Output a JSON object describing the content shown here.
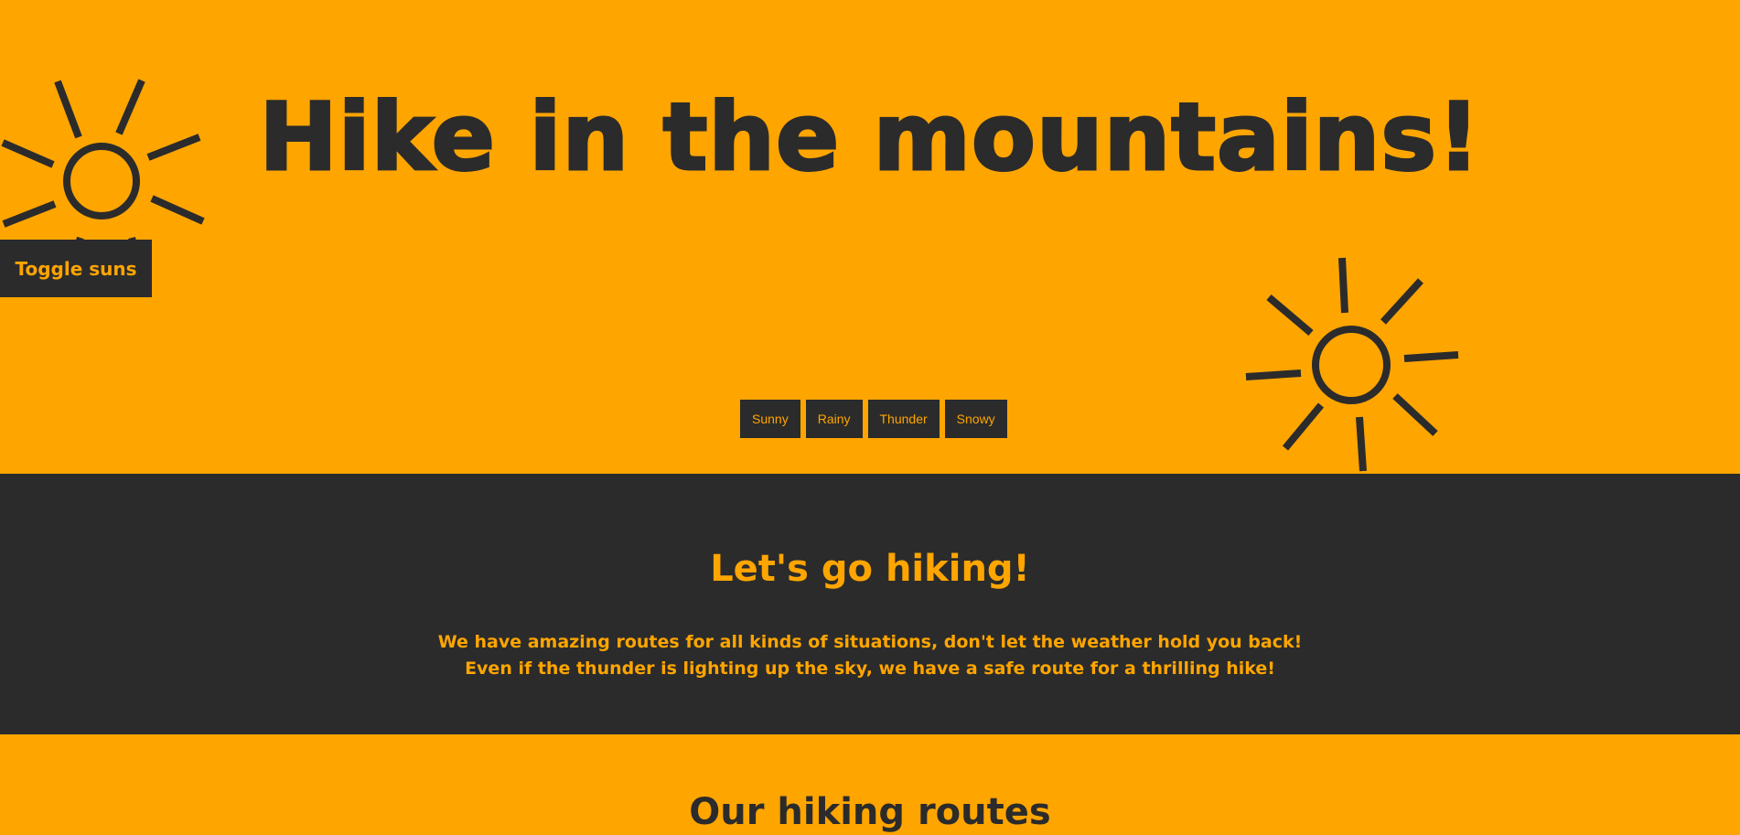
{
  "hero": {
    "title": "Hike in the mountains!",
    "toggle_label": "Toggle suns",
    "weather_buttons": [
      "Sunny",
      "Rainy",
      "Thunder",
      "Snowy"
    ]
  },
  "info": {
    "title": "Let's go hiking!",
    "line1": "We have amazing routes for all kinds of situations, don't let the weather hold you back!",
    "line2": "Even if the thunder is lighting up the sky, we have a safe route for a thrilling hike!"
  },
  "routes": {
    "title": "Our hiking routes"
  },
  "colors": {
    "accent": "#ffa500",
    "dark": "#2b2b2b"
  },
  "icons": {
    "sun": "sun-icon"
  }
}
